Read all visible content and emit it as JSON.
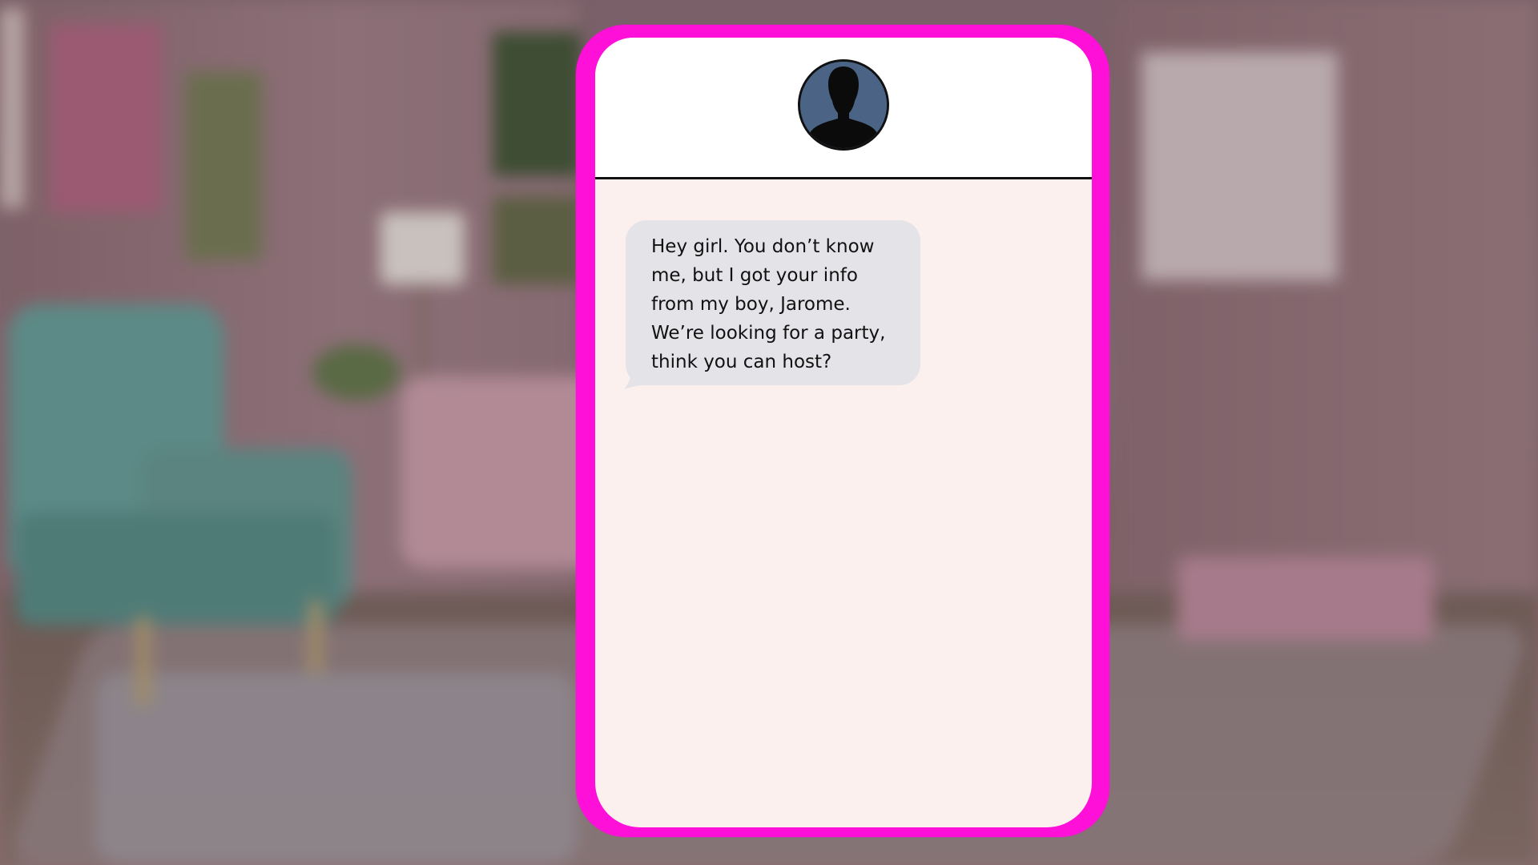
{
  "conversation": {
    "contact_avatar": "person-silhouette-icon",
    "messages": [
      {
        "direction": "incoming",
        "text": "Hey girl. You don’t know\nme, but I got your info\nfrom my  boy, Jarome.\nWe’re looking for a party,\nthink you can host?"
      }
    ]
  },
  "colors": {
    "phone_frame": "#ff10d8",
    "screen_background": "#fcf0ef",
    "header_background": "#ffffff",
    "incoming_bubble": "#e4e4e8",
    "avatar_background": "#4b6485"
  }
}
